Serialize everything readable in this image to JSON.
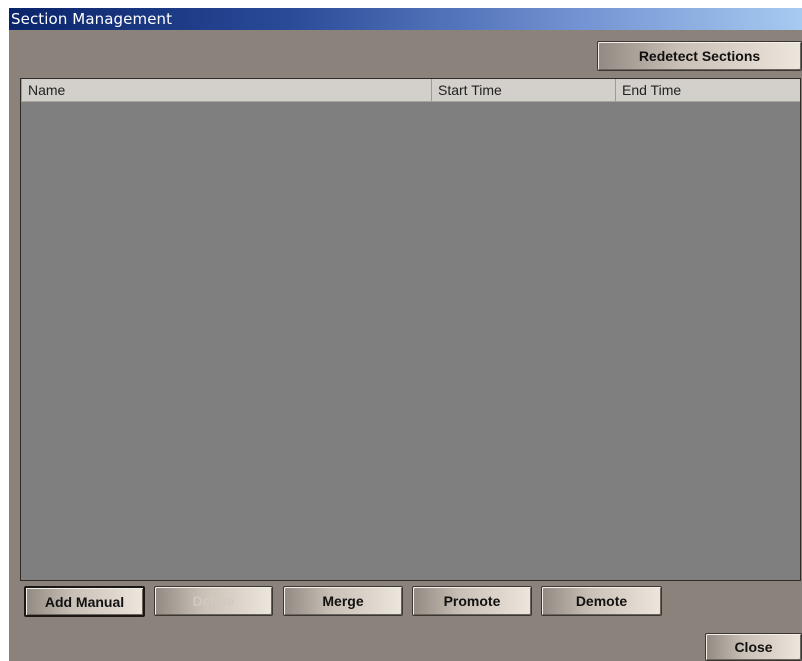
{
  "window": {
    "title": "Section Management"
  },
  "toolbar": {
    "redetect_label": "Redetect Sections"
  },
  "table": {
    "columns": [
      "Name",
      "Start Time",
      "End Time"
    ],
    "rows": []
  },
  "actions": {
    "add_manual": "Add Manual",
    "delete": "Delete",
    "merge": "Merge",
    "promote": "Promote",
    "demote": "Demote"
  },
  "footer": {
    "close_label": "Close"
  },
  "colors": {
    "panel_bg": "#8b837b",
    "list_bg": "#7f7f7f",
    "title_gradient_start": "#0a246a",
    "title_gradient_end": "#a6caf0"
  }
}
